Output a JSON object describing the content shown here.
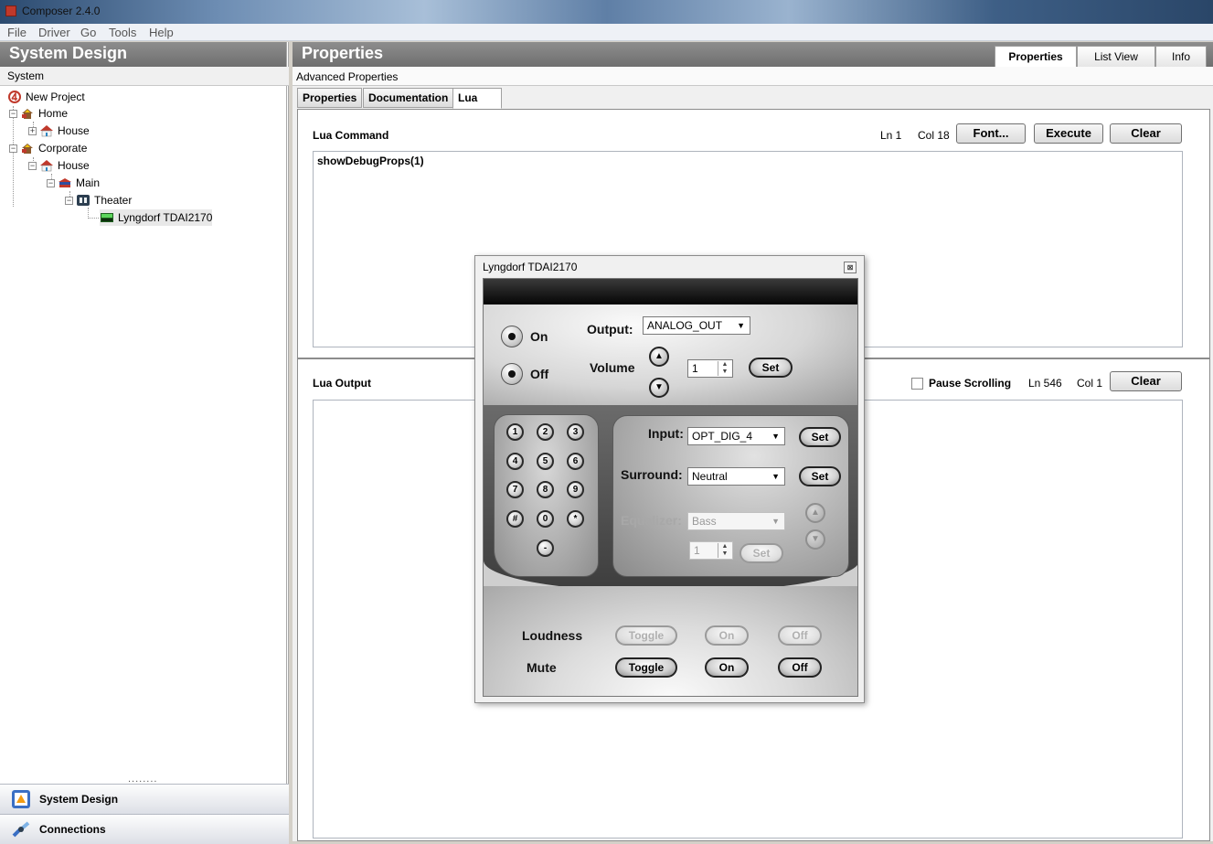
{
  "window": {
    "title": "Composer 2.4.0"
  },
  "menu": [
    "File",
    "Driver",
    "Go",
    "Tools",
    "Help"
  ],
  "left": {
    "header": "System Design",
    "subheader": "System",
    "tree": [
      {
        "label": "New Project"
      },
      {
        "label": "Home"
      },
      {
        "label": "House"
      },
      {
        "label": "Corporate"
      },
      {
        "label": "House"
      },
      {
        "label": "Main"
      },
      {
        "label": "Theater"
      },
      {
        "label": "Lyngdorf TDAI2170"
      }
    ],
    "splitter": "........",
    "nav": [
      "System Design",
      "Connections"
    ]
  },
  "right": {
    "header": "Properties",
    "view_tabs": [
      "Properties",
      "List View",
      "Info"
    ],
    "advanced": "Advanced Properties",
    "sub_tabs": [
      "Properties",
      "Documentation",
      "Lua"
    ],
    "command": {
      "title": "Lua Command",
      "ln": "Ln 1",
      "col": "Col 18",
      "font_btn": "Font...",
      "execute_btn": "Execute",
      "clear_btn": "Clear",
      "text": "showDebugProps(1)"
    },
    "output": {
      "title": "Lua Output",
      "pause": "Pause Scrolling",
      "ln": "Ln 546",
      "col": "Col 1",
      "clear_btn": "Clear"
    }
  },
  "dialog": {
    "title": "Lyngdorf TDAI2170",
    "close_glyph": "⊠",
    "on_label": "On",
    "off_label": "Off",
    "output_label": "Output:",
    "output_value": "ANALOG_OUT",
    "volume_label": "Volume",
    "volume_value": "1",
    "set_label": "Set",
    "keypad": [
      "1",
      "2",
      "3",
      "4",
      "5",
      "6",
      "7",
      "8",
      "9",
      "#",
      "0",
      "*",
      "-"
    ],
    "input_label": "Input:",
    "input_value": "OPT_DIG_4",
    "surround_label": "Surround:",
    "surround_value": "Neutral",
    "equalizer_label": "Equalizer:",
    "equalizer_value": "Bass",
    "eq_value": "1",
    "loudness_label": "Loudness",
    "mute_label": "Mute",
    "toggle_label": "Toggle",
    "on_btn": "On",
    "off_btn": "Off"
  }
}
